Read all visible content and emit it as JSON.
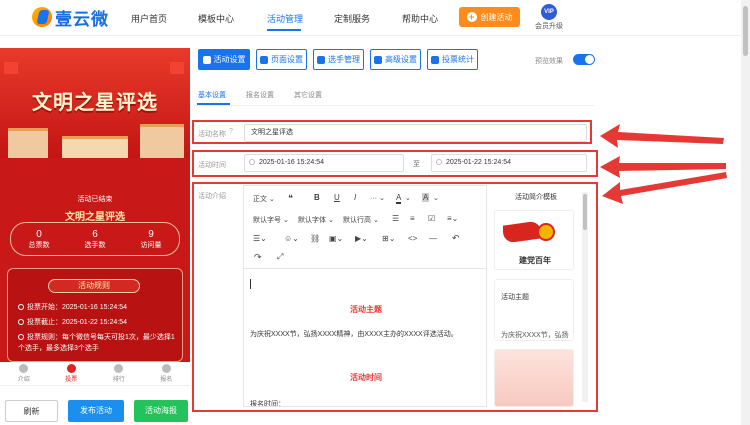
{
  "brand": {
    "name": "壹云微"
  },
  "nav": {
    "items": [
      "用户首页",
      "模板中心",
      "活动管理",
      "定制服务",
      "帮助中心"
    ],
    "active_index": 2,
    "create_label": "创建活动",
    "vip_badge": "VIP",
    "vip_label": "会员升级"
  },
  "preview": {
    "poster_title": "文明之星评选",
    "card_title": "文明之星评选",
    "status": "活动已结束",
    "stats": [
      {
        "value": "0",
        "label": "总票数"
      },
      {
        "value": "6",
        "label": "选手数"
      },
      {
        "value": "9",
        "label": "访问量"
      }
    ],
    "rules_title": "活动规则",
    "rules": [
      "投票开始：2025-01-16 15:24:54",
      "投票截止：2025-01-22 15:24:54",
      "投票规则：每个微信号每天可投1次，最少选择1个选手，最多选择3个选手"
    ],
    "tabs": [
      "介绍",
      "投票",
      "排行",
      "报名"
    ],
    "active_tab": 1,
    "buttons": {
      "refresh": "刷新",
      "publish": "发布活动",
      "poster": "活动海报"
    }
  },
  "toolbar": {
    "buttons": [
      "活动设置",
      "页面设置",
      "选手管理",
      "高级设置",
      "投票统计"
    ],
    "active_index": 0,
    "preview_effect_label": "预览效果",
    "preview_effect_on": true
  },
  "subtabs": {
    "items": [
      "基本设置",
      "报名设置",
      "其它设置"
    ],
    "active_index": 0
  },
  "form": {
    "name_label": "活动名称",
    "name_value": "文明之星评选",
    "time_label": "活动时间",
    "start_time": "2025-01-16 15:24:54",
    "to_label": "至",
    "end_time": "2025-01-22 15:24:54",
    "intro_label": "活动介绍"
  },
  "editor": {
    "toolbar_row1": [
      "正文",
      "❝",
      "B",
      "U",
      "I",
      "···",
      "A",
      "A"
    ],
    "toolbar_row2": [
      "默认字号",
      "默认字体",
      "默认行高"
    ],
    "content": {
      "heading1": "活动主题",
      "para1": "为庆祝XXXX节，弘扬XXXX精神，由XXXX主办的XXXX评选活动。",
      "heading2": "活动时间",
      "para2": "报名时间："
    }
  },
  "templates": {
    "title": "活动简介模板",
    "card1_text": "建党百年",
    "card2_title": "活动主题",
    "card2_text": "为庆祝XXXX节，弘扬"
  },
  "colors": {
    "accent": "#1a73e8",
    "orange": "#ff8c1a",
    "red": "#e53935",
    "poster_red": "#c81818",
    "green": "#21c35a"
  }
}
